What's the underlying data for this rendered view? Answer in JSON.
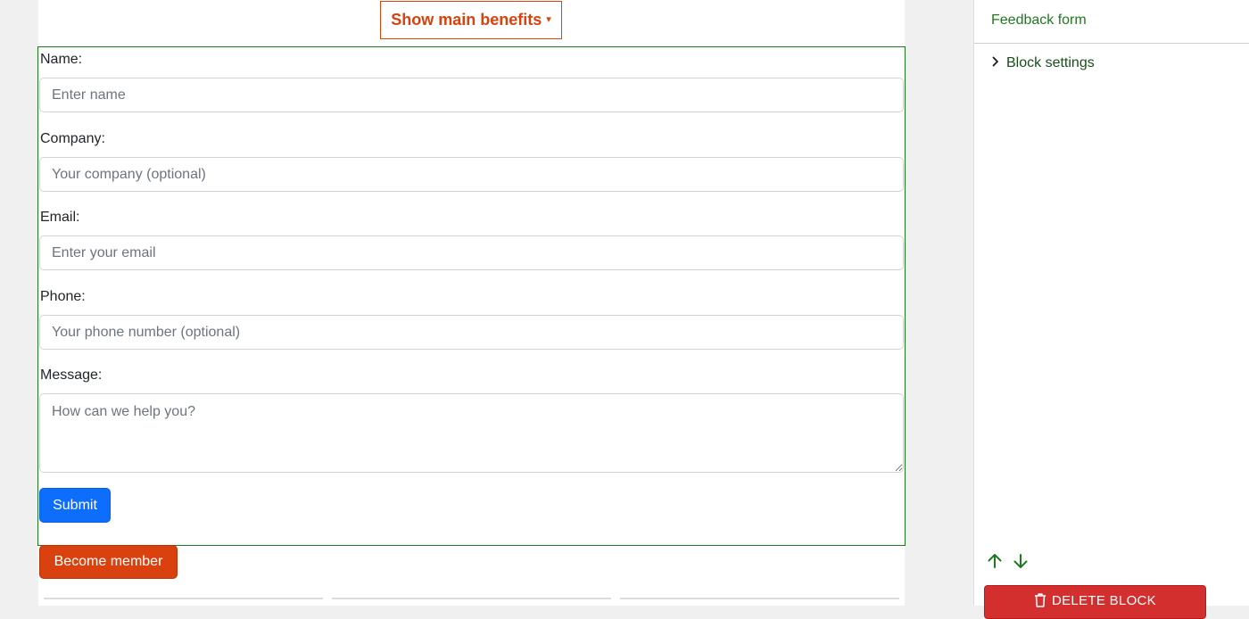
{
  "benefits": {
    "label": "Show main benefits",
    "caret": "▾"
  },
  "form": {
    "name": {
      "label": "Name:",
      "placeholder": "Enter name"
    },
    "company": {
      "label": "Company:",
      "placeholder": "Your company (optional)"
    },
    "email": {
      "label": "Email:",
      "placeholder": "Enter your email"
    },
    "phone": {
      "label": "Phone:",
      "placeholder": "Your phone number (optional)"
    },
    "message": {
      "label": "Message:",
      "placeholder": "How can we help you?"
    },
    "submit_label": "Submit"
  },
  "become_member_label": "Become member",
  "sidebar": {
    "title": "Feedback form",
    "block_settings_label": "Block settings",
    "delete_label": "DELETE BLOCK",
    "icons": [
      "chevron-right-icon",
      "arrow-up-icon",
      "arrow-down-icon",
      "trash-icon"
    ]
  },
  "colors": {
    "accent_green": "#1e7a1e",
    "accent_orange": "#d9410e",
    "primary_blue": "#0d6efd",
    "danger_red": "#d32f2f"
  }
}
